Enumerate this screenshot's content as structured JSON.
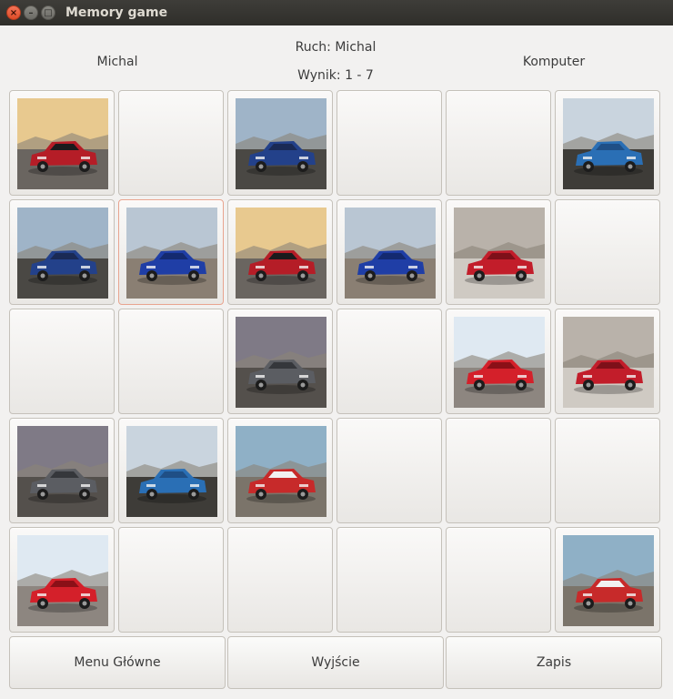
{
  "window": {
    "title": "Memory game",
    "close_glyph": "×",
    "minimize_glyph": "–",
    "maximize_glyph": "□"
  },
  "header": {
    "player_left": "Michal",
    "player_right": "Komputer",
    "turn": "Ruch: Michal",
    "score": "Wynik: 1 - 7"
  },
  "board": {
    "rows": 5,
    "cols": 6,
    "cards": [
      [
        "bmw-i3-red",
        null,
        "porsche-panamera-blue",
        null,
        null,
        "audi-tt-blue"
      ],
      [
        "porsche-panamera-blue",
        "bmw-m5-blue",
        "bmw-i3-red",
        "bmw-m5-blue",
        "peugeot-308-red",
        null
      ],
      [
        null,
        null,
        "jaguar-ipace-grey",
        null,
        "kia-rio-red",
        "peugeot-308-red"
      ],
      [
        "jaguar-ipace-grey",
        "audi-tt-blue",
        "mini-cooper-red",
        null,
        null,
        null
      ],
      [
        "kia-rio-red",
        null,
        null,
        null,
        null,
        "mini-cooper-red"
      ]
    ],
    "focused_card": [
      1,
      1
    ]
  },
  "car_photos": {
    "bmw-i3-red": {
      "sky": "#e8c98f",
      "body": "#b51d27",
      "roof": "#1b1b1d",
      "ground": "#6a6560"
    },
    "porsche-panamera-blue": {
      "sky": "#9fb4c8",
      "body": "#23418a",
      "roof": "#1a2a55",
      "ground": "#4a4844"
    },
    "audi-tt-blue": {
      "sky": "#c9d4de",
      "body": "#2a6fb5",
      "roof": "#1f4f86",
      "ground": "#3e3c38"
    },
    "bmw-m5-blue": {
      "sky": "#b9c6d3",
      "body": "#1f3ea6",
      "roof": "#142a70",
      "ground": "#8a7f73"
    },
    "peugeot-308-red": {
      "sky": "#b9b2aa",
      "body": "#c21d2a",
      "roof": "#7e1019",
      "ground": "#cfcac3"
    },
    "jaguar-ipace-grey": {
      "sky": "#7f7a86",
      "body": "#5b5d62",
      "roof": "#35373b",
      "ground": "#54504c"
    },
    "kia-rio-red": {
      "sky": "#dfe9f2",
      "body": "#d4202a",
      "roof": "#8b1017",
      "ground": "#8d8680"
    },
    "mini-cooper-red": {
      "sky": "#8fb0c6",
      "body": "#c72a2a",
      "roof": "#f1f1f1",
      "ground": "#7b746a"
    }
  },
  "buttons": {
    "main_menu": "Menu Główne",
    "exit": "Wyjście",
    "save": "Zapis"
  }
}
